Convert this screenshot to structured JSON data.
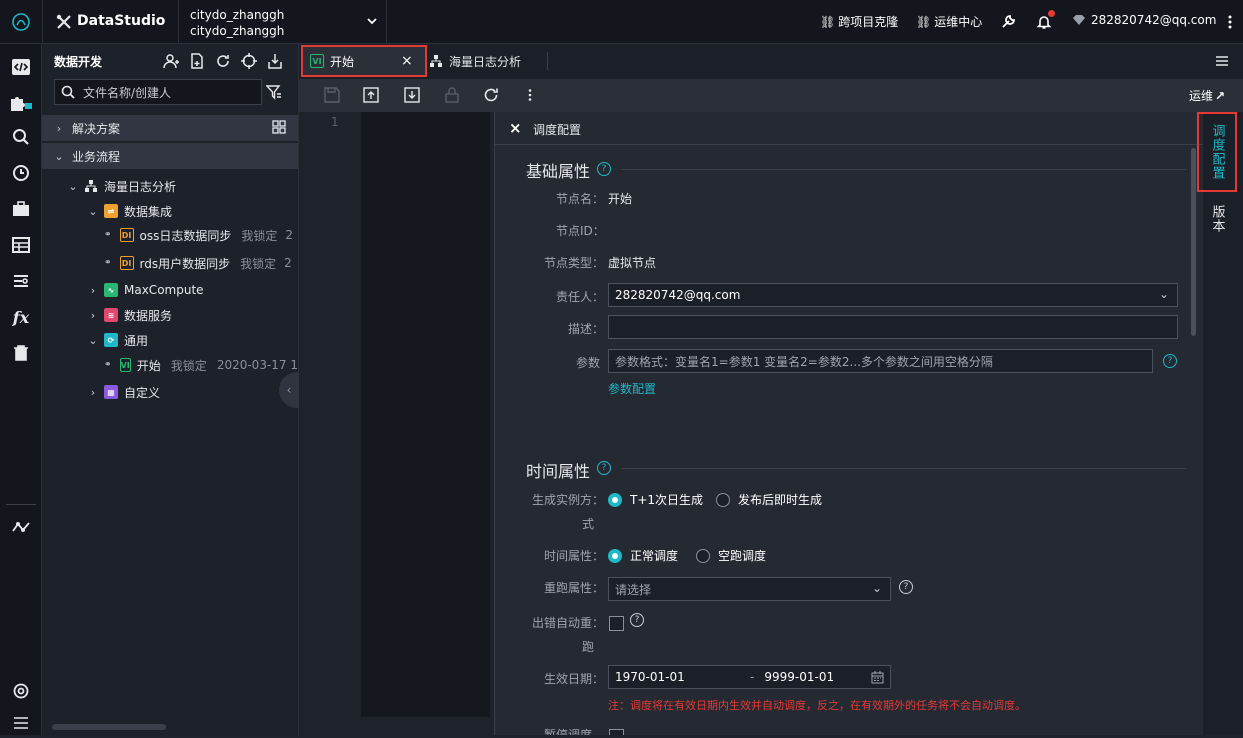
{
  "topbar": {
    "app_name": "DataStudio",
    "project_line1": "citydo_zhanggh",
    "project_line2": "citydo_zhanggh",
    "link_clone": "跨项目克隆",
    "link_ops": "运维中心",
    "user": "282820742@qq.com"
  },
  "sidebar": {
    "title": "数据开发",
    "search_placeholder": "文件名称/创建人",
    "sections": {
      "solutions": "解决方案",
      "workflow": "业务流程"
    },
    "flow_name": "海量日志分析",
    "data_integration": "数据集成",
    "tasks": [
      {
        "name": "oss日志数据同步",
        "lock": "我锁定",
        "trail": "2",
        "badge": "DI"
      },
      {
        "name": "rds用户数据同步",
        "lock": "我锁定",
        "trail": "2",
        "badge": "DI"
      }
    ],
    "maxcompute": "MaxCompute",
    "data_service": "数据服务",
    "general": "通用",
    "start_node": {
      "name": "开始",
      "lock": "我锁定",
      "date": "2020-03-17 1",
      "badge": "VI"
    },
    "custom": "自定义"
  },
  "tabs": [
    {
      "label": "开始",
      "badge": "VI"
    },
    {
      "label": "海量日志分析"
    }
  ],
  "toolbar": {
    "ops_label": "运维"
  },
  "editor": {
    "line_no": "1"
  },
  "panel": {
    "header": "调度配置",
    "basic_section": "基础属性",
    "node_name_label": "节点名：",
    "node_name": "开始",
    "node_id_label": "节点ID：",
    "node_type_label": "节点类型：",
    "node_type": "虚拟节点",
    "owner_label": "责任人：",
    "owner": "282820742@qq.com",
    "desc_label": "描述：",
    "params_label": "参数",
    "params_placeholder": "参数格式：变量名1=参数1 变量名2=参数2...多个参数之间用空格分隔",
    "params_link": "参数配置",
    "time_section": "时间属性",
    "gen_mode_label_1": "生成实例方：",
    "gen_mode_label_2": "式",
    "gen_opt1": "T+1次日生成",
    "gen_opt2": "发布后即时生成",
    "time_attr_label": "时间属性：",
    "time_opt1": "正常调度",
    "time_opt2": "空跑调度",
    "rerun_label": "重跑属性：",
    "rerun_placeholder": "请选择",
    "auto_rerun_label_1": "出错自动重：",
    "auto_rerun_label_2": "跑",
    "effect_label": "生效日期：",
    "start_date": "1970-01-01",
    "date_sep": "-",
    "end_date": "9999-01-01",
    "note": "注：调度将在有效日期内生效并自动调度，反之，在有效期外的任务将不会自动调度。",
    "pause_label": "暂停调度"
  },
  "rightrail": {
    "tab1": "调度配置",
    "tab2": "版本"
  },
  "colors": {
    "accent": "#1fb8c8",
    "highlight": "#e53935",
    "bg": "#1e222b"
  }
}
